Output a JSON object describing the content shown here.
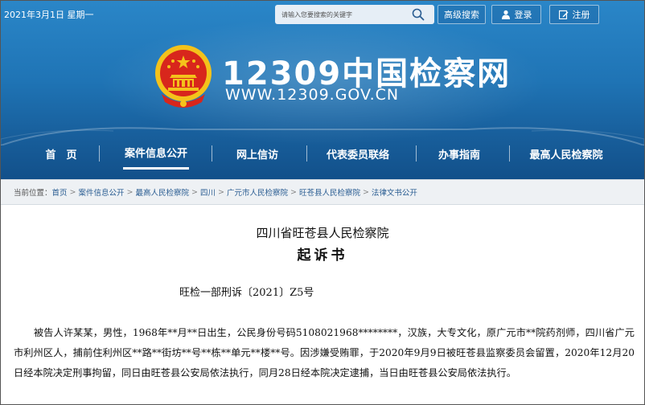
{
  "topbar": {
    "date": "2021年3月1日 星期一",
    "search_placeholder": "请输入您要搜索的关键字",
    "advanced_search": "高级搜索",
    "login": "登录",
    "register": "注册"
  },
  "logo": {
    "title": "12309中国检察网",
    "url": "WWW.12309.GOV.CN"
  },
  "nav": {
    "items": [
      "首　页",
      "案件信息公开",
      "网上信访",
      "代表委员联络",
      "办事指南",
      "最高人民检察院"
    ],
    "active_index": 1
  },
  "breadcrumb": {
    "label": "当前位置：",
    "items": [
      "首页",
      "案件信息公开",
      "最高人民检察院",
      "四川",
      "广元市人民检察院",
      "旺苍县人民检察院",
      "法律文书公开"
    ]
  },
  "document": {
    "org": "四川省旺苍县人民检察院",
    "title": "起诉书",
    "number": "旺检一部刑诉〔2021〕Z5号",
    "paragraph": "被告人许某某，男性，1968年**月**日出生，公民身份号码5108021968********，汉族，大专文化，原广元市**院药剂师，四川省广元市利州区人，捕前住利州区**路**街坊**号**栋**单元**楼**号。因涉嫌受贿罪，于2020年9月9日被旺苍县监察委员会留置，2020年12月20日经本院决定刑事拘留，同日由旺苍县公安局依法执行，同月28日经本院决定逮捕，当日由旺苍县公安局依法执行。"
  },
  "colors": {
    "banner": "#1f74b5",
    "emblem_red": "#d8261c",
    "emblem_gold": "#f4c21b",
    "crumb_link": "#2a5d92"
  }
}
